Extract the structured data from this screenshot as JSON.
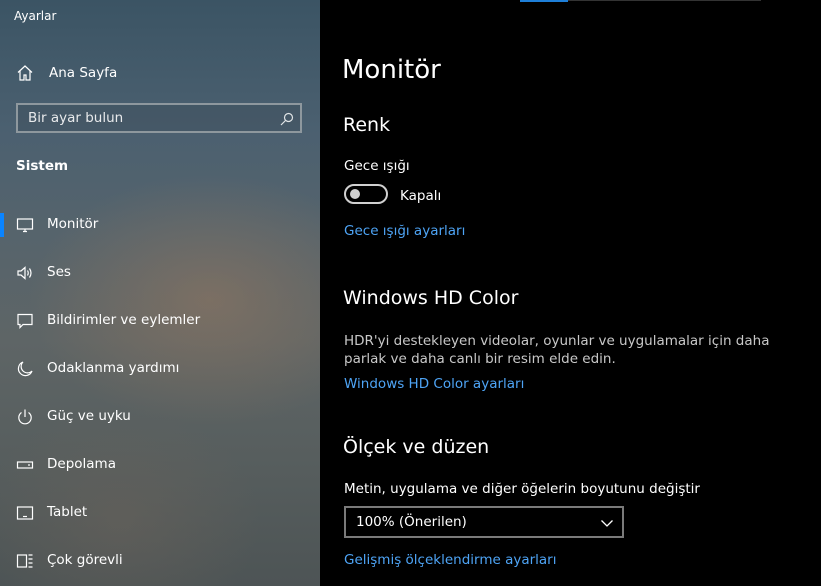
{
  "window": {
    "title": "Ayarlar"
  },
  "sidebar": {
    "home_label": "Ana Sayfa",
    "search_placeholder": "Bir ayar bulun",
    "section_title": "Sistem",
    "items": [
      {
        "label": "Monitör",
        "icon": "monitor-icon",
        "selected": true
      },
      {
        "label": "Ses",
        "icon": "speaker-icon"
      },
      {
        "label": "Bildirimler ve eylemler",
        "icon": "notification-icon"
      },
      {
        "label": "Odaklanma yardımı",
        "icon": "moon-icon"
      },
      {
        "label": "Güç ve uyku",
        "icon": "power-icon"
      },
      {
        "label": "Depolama",
        "icon": "storage-icon"
      },
      {
        "label": "Tablet",
        "icon": "tablet-icon"
      },
      {
        "label": "Çok görevli",
        "icon": "multitasking-icon"
      }
    ]
  },
  "main": {
    "page_title": "Monitör",
    "color_section": {
      "heading": "Renk",
      "night_light_label": "Gece ışığı",
      "night_light_state": "Kapalı",
      "night_light_on": false,
      "night_light_settings_link": "Gece ışığı ayarları"
    },
    "hd_color_section": {
      "heading": "Windows HD Color",
      "description": "HDR'yi destekleyen videolar, oyunlar ve uygulamalar için daha parlak ve daha canlı bir resim elde edin.",
      "settings_link": "Windows HD Color ayarları"
    },
    "scale_section": {
      "heading": "Ölçek ve düzen",
      "scale_label": "Metin, uygulama ve diğer öğelerin boyutunu değiştir",
      "scale_value": "100% (Önerilen)",
      "advanced_link": "Gelişmiş ölçeklendirme ayarları"
    }
  },
  "colors": {
    "accent": "#0a84ff",
    "link": "#4ea4f5",
    "content_bg": "#000000"
  }
}
